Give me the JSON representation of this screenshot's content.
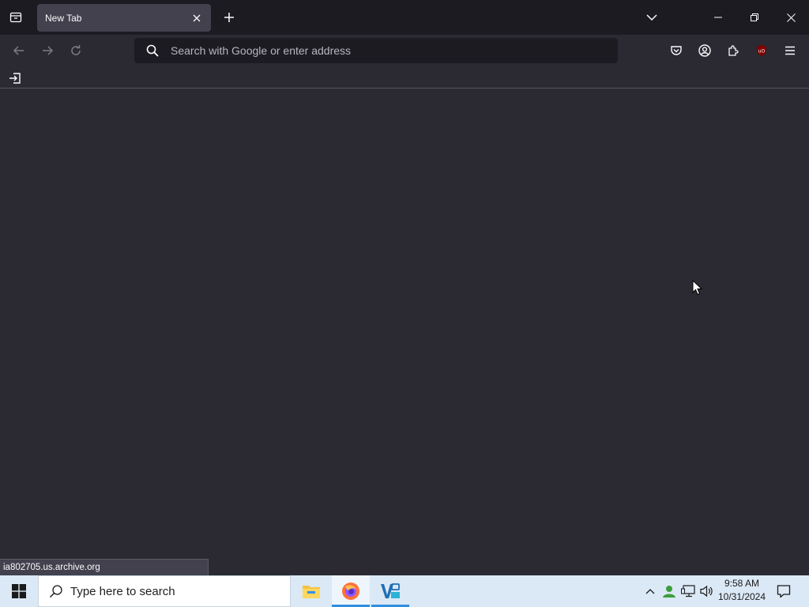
{
  "tabs": [
    {
      "title": "New Tab",
      "active": true
    }
  ],
  "urlbar": {
    "placeholder": "Search with Google or enter address",
    "value": ""
  },
  "status": {
    "text": "ia802705.us.archive.org"
  },
  "taskbar": {
    "search_placeholder": "Type here to search",
    "apps": [
      "file-explorer",
      "firefox",
      "visual-studio"
    ],
    "active_app": "firefox",
    "clock": {
      "time": "9:58 AM",
      "date": "10/31/2024"
    }
  },
  "icons": {
    "tab_list": "firefox-view-icon",
    "tab_close": "close-icon",
    "new_tab": "plus-icon",
    "list_all_tabs": "chevron-down-icon",
    "back": "arrow-left-icon",
    "forward": "arrow-right-icon",
    "reload": "reload-icon",
    "url_search": "search-icon",
    "pocket": "pocket-icon",
    "account": "account-icon",
    "extensions": "puzzle-icon",
    "ublock": "ublock-origin-icon",
    "menu": "hamburger-menu-icon",
    "import_bookmarks": "import-icon"
  },
  "colors": {
    "chrome_dark": "#1c1b22",
    "toolbar": "#2b2a33",
    "tab_active": "#42414d",
    "text": "#fbfbfe",
    "ublock_red": "#800000",
    "taskbar": "#dbe8f5",
    "taskbar_accent": "#2f8ee0"
  }
}
